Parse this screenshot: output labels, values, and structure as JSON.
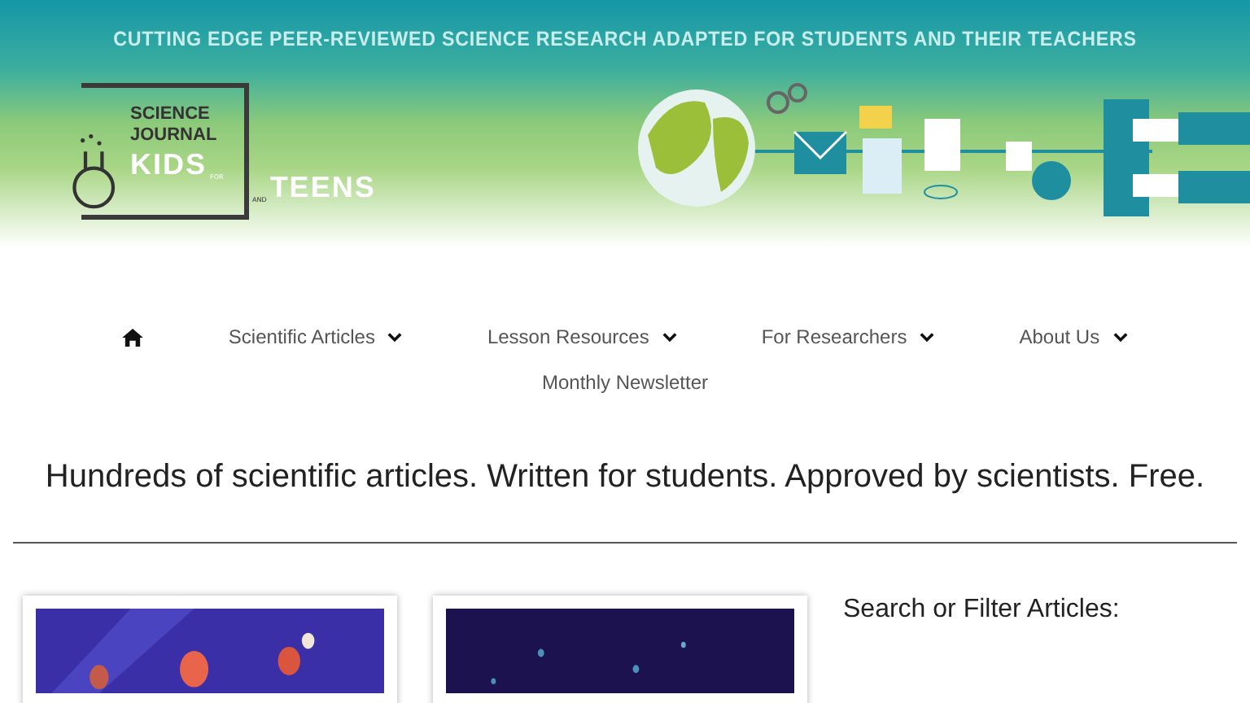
{
  "banner": {
    "tagline": "CUTTING EDGE PEER-REVIEWED SCIENCE RESEARCH ADAPTED FOR STUDENTS AND THEIR TEACHERS",
    "logo": {
      "line_1": "SCIENCE",
      "line_2": "JOURNAL",
      "kids": "KIDS",
      "for": "FOR",
      "and": "AND",
      "teens": "TEENS"
    }
  },
  "nav": {
    "items": [
      {
        "label": "Scientific Articles",
        "dropdown": true
      },
      {
        "label": "Lesson Resources",
        "dropdown": true
      },
      {
        "label": "For Researchers",
        "dropdown": true
      },
      {
        "label": "About Us",
        "dropdown": true
      },
      {
        "label": "Monthly Newsletter",
        "dropdown": false
      }
    ]
  },
  "headline": "Hundreds of scientific articles. Written for students. Approved by scientists. Free.",
  "sidebar": {
    "heading": "Search or Filter Articles:"
  }
}
